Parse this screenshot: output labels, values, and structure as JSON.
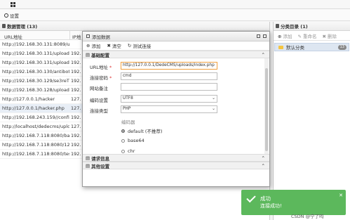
{
  "toolbar": {
    "settings_label": "设置"
  },
  "left_panel": {
    "title": "数据管理 (13)",
    "columns": [
      "URL地址",
      "IP地"
    ],
    "rows": [
      {
        "url": "http://192.168.30.131:8089/uplo",
        "ip": ""
      },
      {
        "url": "http://192.168.30.131/uploadfiles",
        "ip": "192."
      },
      {
        "url": "http://192.168.30.131/uploadfiles",
        "ip": "192."
      },
      {
        "url": "http://192.168.30.130/antibot_ima",
        "ip": "192."
      },
      {
        "url": "http://192.168.30.129/se3reTdir7",
        "ip": "192."
      },
      {
        "url": "http://192.168.30.128/uploads/sh",
        "ip": "192."
      },
      {
        "url": "http://127.0.0.1/hacker",
        "ip": "127."
      },
      {
        "url": "http://127.0.0.1/hacker.php",
        "ip": "127."
      },
      {
        "url": "http://192.168.243.159//config/Ac",
        "ip": "192."
      },
      {
        "url": "http://localhost/dedecms/uploads/",
        "ip": "127."
      },
      {
        "url": "http://192.168.7.118:8080/bak.p",
        "ip": "192."
      },
      {
        "url": "http://192.168.7.118:8080/123.p",
        "ip": "192."
      },
      {
        "url": "http://192.168.7.118:8080/test.p",
        "ip": "192."
      }
    ]
  },
  "right_panel": {
    "title": "分类目录 (1)",
    "tools": {
      "add": "添加",
      "rename": "重命名",
      "delete": "删除"
    },
    "categories": [
      {
        "name": "默认分类",
        "count": "13"
      }
    ]
  },
  "dialog": {
    "title": "添加数据",
    "tools": {
      "add": "添加",
      "clear": "清空",
      "test": "测试连接"
    },
    "sections": {
      "basic": "基础配置",
      "request": "请求信息",
      "other": "其他设置"
    },
    "form": {
      "url_label": "URL地址",
      "url_value": "http://127.0.0.1/DedeCMS/uploads/index.php",
      "password_label": "连接密码",
      "password_value": "cmd",
      "note_label": "网站备注",
      "note_value": "",
      "encoding_label": "编码设置",
      "encoding_value": "UTF8",
      "type_label": "连接类型",
      "type_value": "PHP",
      "encoder_label": "编码器",
      "encoders": [
        "default (不推荐)",
        "base64",
        "chr"
      ]
    }
  },
  "toast": {
    "title": "成功",
    "message": "连接成功!"
  },
  "watermark": "CSDN @宁了吗"
}
